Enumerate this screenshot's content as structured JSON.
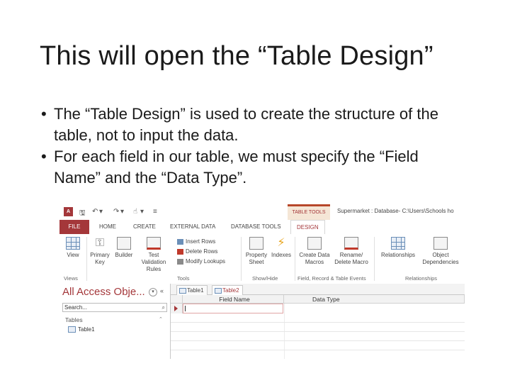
{
  "slide": {
    "title": "This will open the “Table Design”",
    "bullets": [
      "The “Table Design” is used to create the structure of the table, not to input the data.",
      "For each field in our table, we must specify the “Field Name” and the “Data Type”."
    ]
  },
  "access": {
    "colors": {
      "accent": "#a4373a",
      "ribbon_bg": "#ffffff",
      "context_tab_bg": "#f5e6d6"
    },
    "contextual_tab_header": "TABLE TOOLS",
    "window_title": "Supermarket : Database- C:\\Users\\Schools ho",
    "tabs": [
      "FILE",
      "HOME",
      "CREATE",
      "EXTERNAL DATA",
      "DATABASE TOOLS",
      "DESIGN"
    ],
    "active_tab": "DESIGN",
    "ribbon": {
      "view": "View",
      "primary_key": "Primary Key",
      "builder": "Builder",
      "test_validation": "Test Validation Rules",
      "insert_rows": "Insert Rows",
      "delete_rows": "Delete Rows",
      "modify_lookups": "Modify Lookups",
      "property_sheet": "Property Sheet",
      "indexes": "Indexes",
      "create_data_macros": "Create Data Macros",
      "rename_delete_macro": "Rename/ Delete Macro",
      "relationships": "Relationships",
      "object_dependencies": "Object Dependencies",
      "groups": [
        "Views",
        "Tools",
        "Show/Hide",
        "Field, Record & Table Events",
        "Relationships"
      ]
    },
    "nav": {
      "header": "All Access Obje...",
      "search_value": "Search...",
      "section": "Tables",
      "items": [
        "Table1"
      ]
    },
    "doc_tabs": [
      "Table1",
      "Table2"
    ],
    "active_doc_tab": "Table2",
    "grid_columns": [
      "Field Name",
      "Data Type"
    ]
  }
}
